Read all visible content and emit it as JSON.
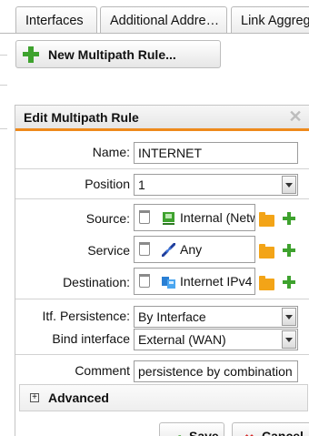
{
  "tabs": [
    {
      "label": "Interfaces"
    },
    {
      "label": "Additional Addre…"
    },
    {
      "label": "Link Aggreg"
    }
  ],
  "toolbar": {
    "new_rule_label": "New Multipath Rule..."
  },
  "dialog": {
    "title": "Edit Multipath Rule",
    "name": {
      "label": "Name:",
      "value": "INTERNET"
    },
    "position": {
      "label": "Position",
      "value": "1"
    },
    "source": {
      "label": "Source:",
      "value": "Internal (Netw"
    },
    "service": {
      "label": "Service",
      "value": "Any"
    },
    "destination": {
      "label": "Destination:",
      "value": "Internet IPv4"
    },
    "itf_persistence": {
      "label": "Itf. Persistence:",
      "value": "By Interface"
    },
    "bind_interface": {
      "label": "Bind interface",
      "value": "External (WAN)"
    },
    "comment": {
      "label": "Comment",
      "value": "persistence by combination"
    },
    "advanced": {
      "label": "Advanced",
      "toggle": "+"
    },
    "save_label": "Save",
    "cancel_label": "Cancel"
  },
  "colors": {
    "accent": "#ee8a1c",
    "add": "#3ea22e",
    "folder": "#f3a417"
  },
  "icons": {
    "close": "close-icon",
    "add": "plus-icon",
    "trash": "trash-icon",
    "network": "network-icon",
    "service": "service-icon",
    "folder": "folder-icon"
  }
}
